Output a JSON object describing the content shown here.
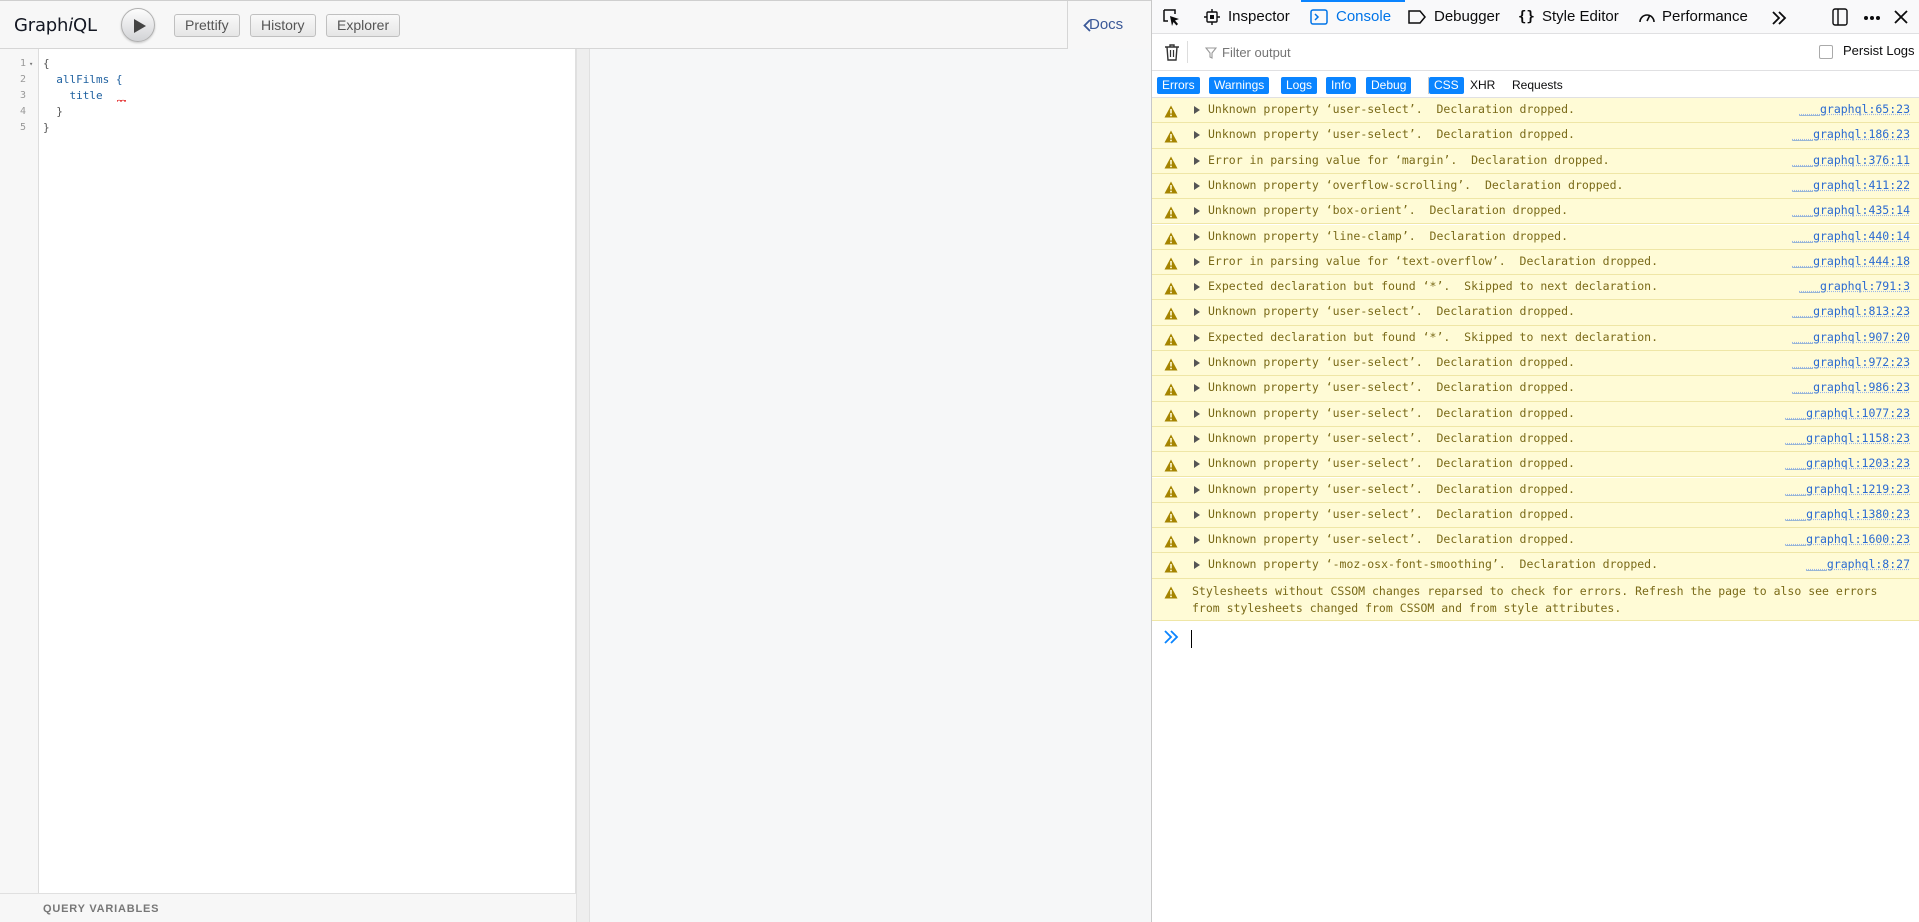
{
  "graphiql": {
    "title_prefix": "Graph",
    "title_italic": "i",
    "title_suffix": "QL",
    "buttons": {
      "prettify": "Prettify",
      "history": "History",
      "explorer": "Explorer"
    },
    "docs_label": "Docs",
    "editor_lines": [
      {
        "n": "1",
        "fold": "▾",
        "code": "{"
      },
      {
        "n": "2",
        "fold": "",
        "code": "  allFilms {"
      },
      {
        "n": "3",
        "fold": "",
        "code": "    title"
      },
      {
        "n": "4",
        "fold": "",
        "code": "  }"
      },
      {
        "n": "5",
        "fold": "",
        "code": "}"
      }
    ],
    "query_variables_label": "QUERY VARIABLES"
  },
  "devtools": {
    "tabs": {
      "inspector": "Inspector",
      "console": "Console",
      "debugger": "Debugger",
      "style_editor": "Style Editor",
      "performance": "Performance"
    },
    "selected_tab": "Console",
    "filter_placeholder": "Filter output",
    "persist_logs": "Persist Logs",
    "filters": {
      "errors": "Errors",
      "warnings": "Warnings",
      "logs": "Logs",
      "info": "Info",
      "debug": "Debug",
      "css": "CSS",
      "xhr": "XHR",
      "requests": "Requests"
    },
    "messages": [
      {
        "text": "Unknown property ‘user-select’.  Declaration dropped.",
        "source": "___graphql:65:23"
      },
      {
        "text": "Unknown property ‘user-select’.  Declaration dropped.",
        "source": "___graphql:186:23"
      },
      {
        "text": "Error in parsing value for ‘margin’.  Declaration dropped.",
        "source": "___graphql:376:11"
      },
      {
        "text": "Unknown property ‘overflow-scrolling’.  Declaration dropped.",
        "source": "___graphql:411:22"
      },
      {
        "text": "Unknown property ‘box-orient’.  Declaration dropped.",
        "source": "___graphql:435:14"
      },
      {
        "text": "Unknown property ‘line-clamp’.  Declaration dropped.",
        "source": "___graphql:440:14"
      },
      {
        "text": "Error in parsing value for ‘text-overflow’.  Declaration dropped.",
        "source": "___graphql:444:18"
      },
      {
        "text": "Expected declaration but found ‘*’.  Skipped to next declaration.",
        "source": "___graphql:791:3"
      },
      {
        "text": "Unknown property ‘user-select’.  Declaration dropped.",
        "source": "___graphql:813:23"
      },
      {
        "text": "Expected declaration but found ‘*’.  Skipped to next declaration.",
        "source": "___graphql:907:20"
      },
      {
        "text": "Unknown property ‘user-select’.  Declaration dropped.",
        "source": "___graphql:972:23"
      },
      {
        "text": "Unknown property ‘user-select’.  Declaration dropped.",
        "source": "___graphql:986:23"
      },
      {
        "text": "Unknown property ‘user-select’.  Declaration dropped.",
        "source": "___graphql:1077:23"
      },
      {
        "text": "Unknown property ‘user-select’.  Declaration dropped.",
        "source": "___graphql:1158:23"
      },
      {
        "text": "Unknown property ‘user-select’.  Declaration dropped.",
        "source": "___graphql:1203:23"
      },
      {
        "text": "Unknown property ‘user-select’.  Declaration dropped.",
        "source": "___graphql:1219:23"
      },
      {
        "text": "Unknown property ‘user-select’.  Declaration dropped.",
        "source": "___graphql:1380:23"
      },
      {
        "text": "Unknown property ‘user-select’.  Declaration dropped.",
        "source": "___graphql:1600:23"
      },
      {
        "text": "Unknown property ‘-moz-osx-font-smoothing’.  Declaration dropped.",
        "source": "___graphql:8:27"
      }
    ],
    "note": "Stylesheets without CSSOM changes reparsed to check for errors. Refresh the page to also see errors from stylesheets changed from CSSOM and from style attributes.",
    "colors": {
      "accent": "#0a84ff",
      "warning_bg": "#fffbd6",
      "warning_text": "#7a6a18",
      "link": "#2a6ad1"
    }
  }
}
